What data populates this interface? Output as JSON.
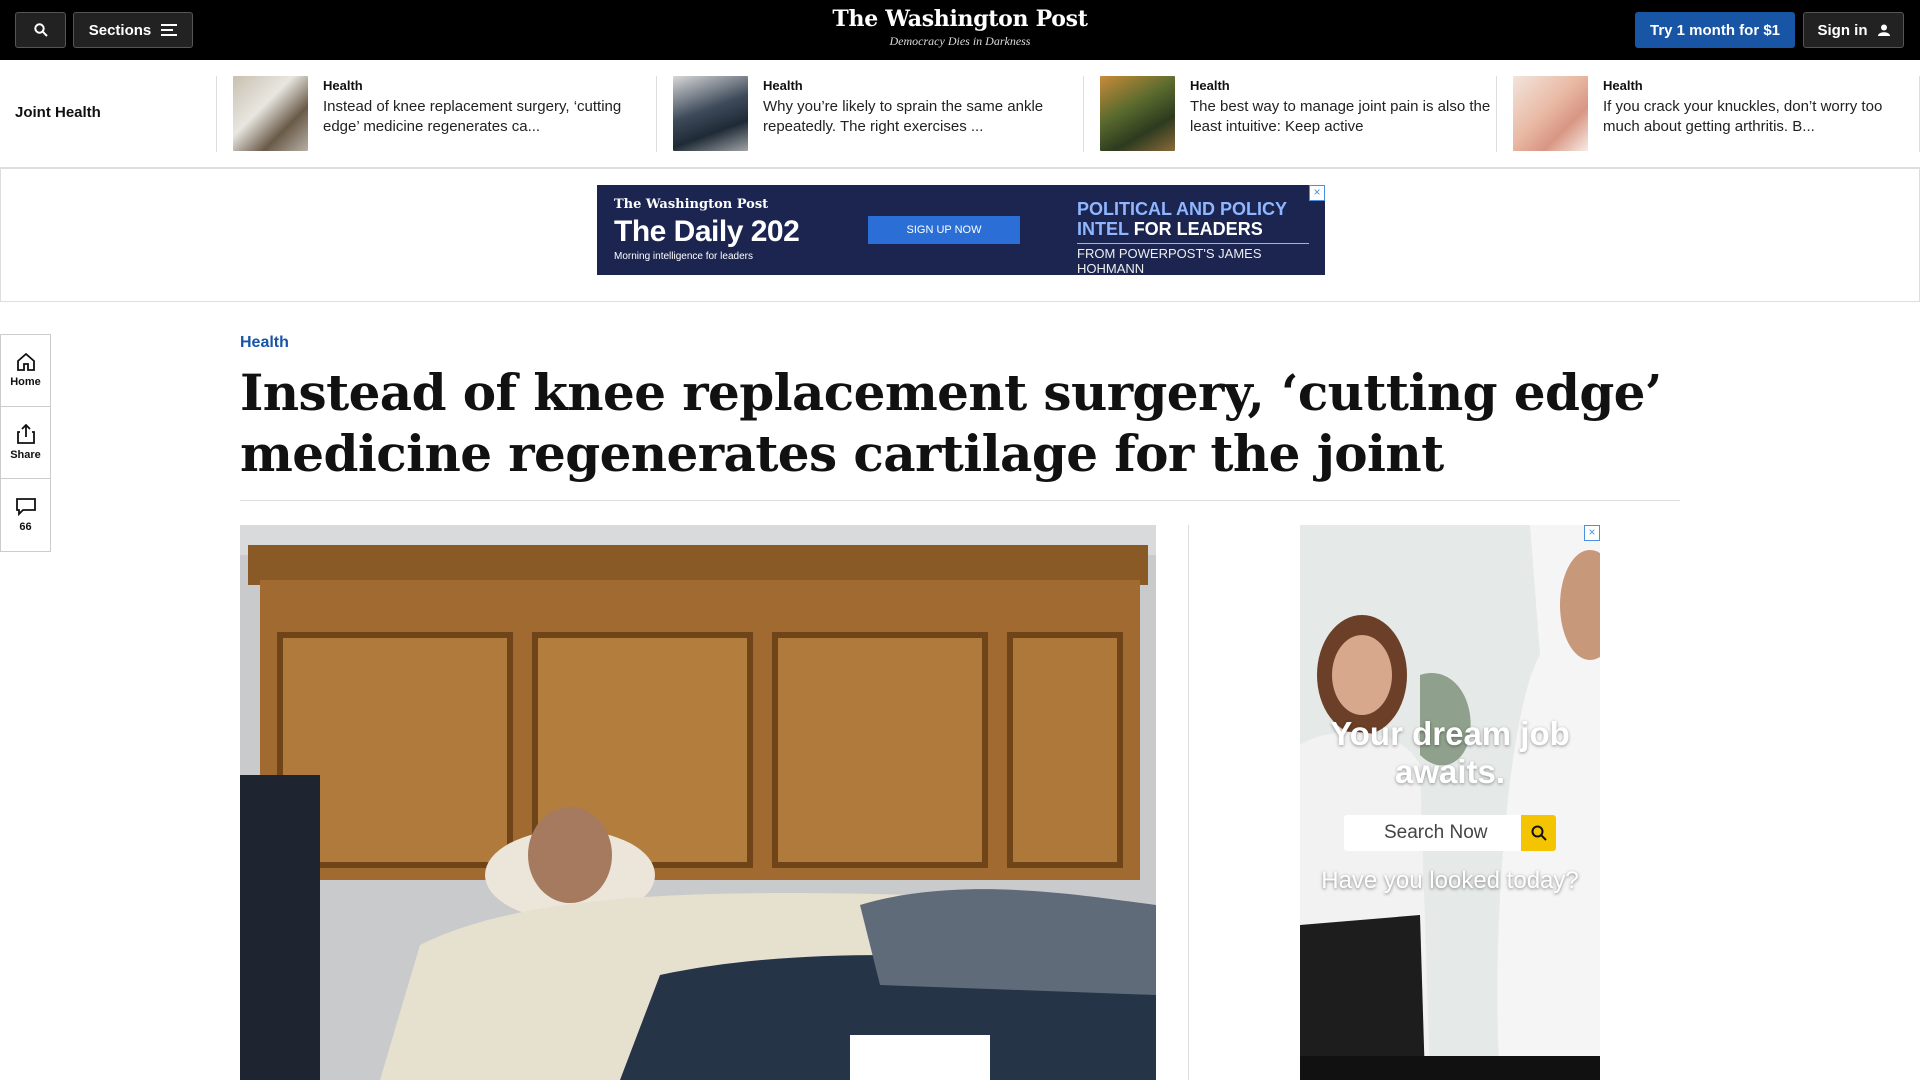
{
  "header": {
    "sections_label": "Sections",
    "logo": "The Washington Post",
    "tagline": "Democracy Dies in Darkness",
    "trial_label": "Try 1 month for $1",
    "signin_label": "Sign in"
  },
  "topic_strip": {
    "title": "Joint Health",
    "items": [
      {
        "kicker": "Health",
        "headline": "Instead of knee replacement surgery, ‘cutting edge’ medicine regenerates ca..."
      },
      {
        "kicker": "Health",
        "headline": "Why you’re likely to sprain the same ankle repeatedly. The right exercises ..."
      },
      {
        "kicker": "Health",
        "headline": "The best way to manage joint pain is also the least intuitive: Keep active"
      },
      {
        "kicker": "Health",
        "headline": "If you crack your knuckles, don’t worry too much about getting arthritis. B..."
      }
    ]
  },
  "banner_ad": {
    "brand": "The Washington Post",
    "title": "The Daily 202",
    "subtitle": "Morning intelligence for leaders",
    "cta": "SIGN UP NOW",
    "promo_line1": "POLITICAL AND POLICY",
    "promo_line2_blue": "INTEL",
    "promo_line2_white": "FOR LEADERS",
    "promo_footer": "FROM POWERPOST'S JAMES HOHMANN"
  },
  "rail": {
    "home_label": "Home",
    "share_label": "Share",
    "comments_count": "66"
  },
  "article": {
    "kicker": "Health",
    "headline": "Instead of knee replacement surgery, ‘cutting edge’ medicine regenerates cartilage for the joint"
  },
  "side_ad": {
    "headline": "Your dream job awaits.",
    "search_placeholder": "Search Now",
    "tagline": "Have you looked today?"
  },
  "colors": {
    "accent_blue": "#1955a5",
    "topbar": "#000000",
    "ad_navy": "#1b2550",
    "ad_yellow": "#f5c400"
  }
}
